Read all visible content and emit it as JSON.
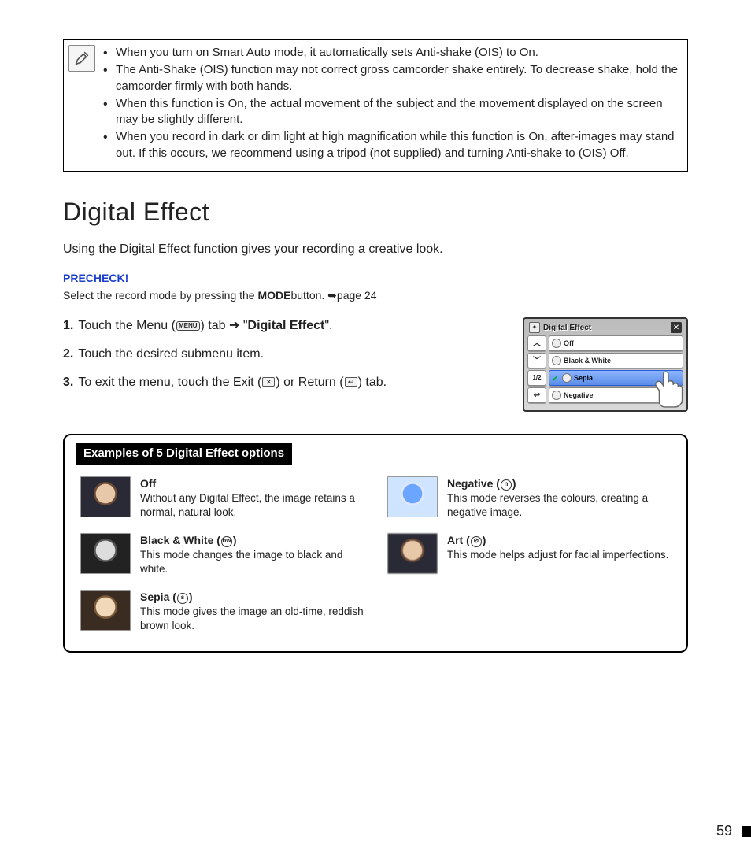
{
  "note": {
    "bullets": [
      "When you turn on Smart Auto mode, it automatically sets Anti-shake (OIS) to On.",
      "The Anti-Shake (OIS) function may not correct gross camcorder shake entirely. To decrease shake, hold the camcorder firmly with both hands.",
      "When this function is On, the actual movement of the subject and the movement displayed on the screen may be slightly different.",
      "When you record in dark or dim light at high magnification while this function is On, after-images may stand out. If this occurs, we recommend using a tripod (not supplied) and turning Anti-shake to (OIS) Off."
    ]
  },
  "section": {
    "title": "Digital Effect",
    "intro": "Using the Digital Effect function gives your recording a creative look.",
    "precheck_label": "PRECHECK!",
    "precheck_text_pre": "Select the record mode by pressing the ",
    "precheck_mode": "MODE",
    "precheck_text_post": " button. ➥page 24"
  },
  "steps": {
    "s1_pre": "Touch the Menu (",
    "s1_menu": "MENU",
    "s1_mid": ") tab ➔ \"",
    "s1_bold": "Digital Effect",
    "s1_post": "\".",
    "s2": "Touch the desired submenu item.",
    "s3_pre": "To exit the menu, touch the Exit (",
    "s3_mid": ") or Return (",
    "s3_post": ") tab."
  },
  "preview": {
    "title": "Digital Effect",
    "page": "1/2",
    "options": [
      "Off",
      "Black & White",
      "Sepia",
      "Negative"
    ],
    "selected": "Sepia"
  },
  "examples": {
    "title": "Examples of 5 Digital Effect options",
    "items": [
      {
        "key": "off",
        "label": "Off",
        "icon": "",
        "desc": "Without any Digital Effect, the image retains a normal, natural look."
      },
      {
        "key": "bw",
        "label": "Black & White",
        "icon": "bw-icon",
        "desc": "This mode changes the image to black and white."
      },
      {
        "key": "sepia",
        "label": "Sepia",
        "icon": "sepia-icon",
        "desc": "This mode gives the image an old-time, reddish brown look."
      },
      {
        "key": "neg",
        "label": "Negative",
        "icon": "negative-icon",
        "desc": "This mode reverses the colours, creating a negative image."
      },
      {
        "key": "art",
        "label": "Art",
        "icon": "art-icon",
        "desc": "This mode helps adjust for facial imperfections."
      }
    ]
  },
  "page_number": "59"
}
